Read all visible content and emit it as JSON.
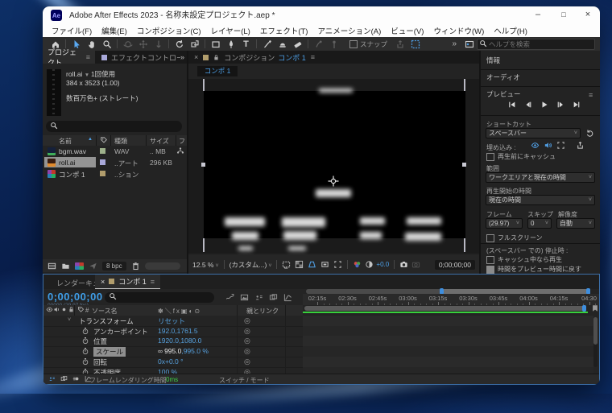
{
  "colors": {
    "accent_blue": "#4da0e8",
    "value_blue": "#56a0dd",
    "cache_green": "#38d03c",
    "selected_row_gray": "#919191"
  },
  "icons": {
    "search": "magnifier",
    "panel_menu": "≡",
    "sort_ascending": "▲",
    "dropdown_chevron": "˅",
    "pick_whip": "◎",
    "scale_link": "∞",
    "collapse_arrow": "˅"
  },
  "window": {
    "title": "Adobe After Effects 2023 - 名称未設定プロジェクト.aep *",
    "controls": {
      "minimize": "–",
      "maximize": "□",
      "close": "×"
    }
  },
  "menu": {
    "items": [
      "ファイル(F)",
      "編集(E)",
      "コンポジション(C)",
      "レイヤー(L)",
      "エフェクト(T)",
      "アニメーション(A)",
      "ビュー(V)",
      "ウィンドウ(W)",
      "ヘルプ(H)"
    ]
  },
  "toolbar": {
    "snap_label": "スナップ",
    "overflow": "»",
    "search_placeholder": "ヘルプを検索"
  },
  "project": {
    "tab_label": "プロジェクト",
    "effect_controls_label": "エフェクトコントロール roll.ai",
    "overflow": "»",
    "preview": {
      "name": "roll.ai",
      "usage": "1回使用",
      "dimensions": "384 x 3523 (1.00)",
      "color_depth": "数百万色+ (ストレート)"
    },
    "columns": {
      "name": "名前",
      "type": "種類",
      "size": "サイズ",
      "clipped": "フ"
    },
    "items": [
      {
        "name": "bgm.wav",
        "type": "WAV",
        "size": ".. MB",
        "label_color": "#9db08a",
        "icon": "audio-file-icon",
        "selected": false
      },
      {
        "name": "roll.ai",
        "type": "..アート",
        "size": "296 KB",
        "label_color": "#a9a9da",
        "icon": "vector-file-icon",
        "selected": true
      },
      {
        "name": "コンポ 1",
        "type": "..ション",
        "size": "",
        "label_color": "#b19d6c",
        "icon": "composition-icon",
        "selected": false
      }
    ],
    "footer": {
      "bpc_label": "8 bpc"
    }
  },
  "composition": {
    "close": "×",
    "panel_label": "コンポジション",
    "comp_name": "コンポ 1",
    "viewer_tab": "コンポ 1",
    "menu_icon": "≡",
    "zoom_value": "12.5 %",
    "grid_preset": "(カスタム...)",
    "exposure_value": "+0.0",
    "timecode": "0;00;00;00"
  },
  "preview_panel": {
    "info_label": "情報",
    "audio_label": "オーディオ",
    "preview_label": "プレビュー",
    "menu_icon": "≡",
    "shortcut_label": "ショートカット",
    "shortcut_value": "スペースバー",
    "include_label": "埋め込み :",
    "cache_before_label": "再生前にキャッシュ",
    "range_label": "範囲",
    "range_value": "ワークエリアと現在の時間",
    "play_from_label": "再生開始の時間",
    "play_from_value": "現在の時間",
    "framerate_label": "フレーム",
    "skip_label": "スキップ",
    "resolution_label": "解像度",
    "framerate_value": "(29.97)",
    "skip_value": "0",
    "resolution_value": "自動",
    "fullscreen_label": "フルスクリーン",
    "on_stop_label": "(スペースバー での) 停止時 :",
    "play_cached_label": "キャッシュ中なら再生",
    "restore_time_label": "時間をプレビュー時間に戻す"
  },
  "timeline": {
    "render_queue_tab": "レンダーキュー",
    "comp_tab": "コンポ 1",
    "tab_close": "×",
    "menu_icon": "≡",
    "timecode": "0;00;00;00",
    "frame_info": "00000 (29.97 fps)",
    "source_name_col": "ソース名",
    "hash_col": "#",
    "parent_link_col": "親とリンク",
    "properties": [
      {
        "kind": "group",
        "name": "トランスフォーム",
        "value": "リセット"
      },
      {
        "kind": "prop",
        "name": "アンカーポイント",
        "value": "192.0,1761.5"
      },
      {
        "kind": "prop",
        "name": "位置",
        "value": "1920.0,1080.0"
      },
      {
        "kind": "prop",
        "name": "スケール",
        "value_white": "995.0",
        "value": ",995.0 %",
        "selected": true,
        "linked": true
      },
      {
        "kind": "prop",
        "name": "回転",
        "value": "0x+0.0 °"
      },
      {
        "kind": "prop",
        "name": "不透明度",
        "value": "100 %"
      }
    ],
    "ruler_ticks": [
      "02:15s",
      "02:30s",
      "02:45s",
      "03:00s",
      "03:15s",
      "03:30s",
      "03:45s",
      "04:00s",
      "04:15s",
      "04:30"
    ],
    "footer": {
      "render_time_label": "フレームレンダリング時間",
      "render_time_value": "0ms",
      "switches_label": "スイッチ / モード"
    }
  }
}
